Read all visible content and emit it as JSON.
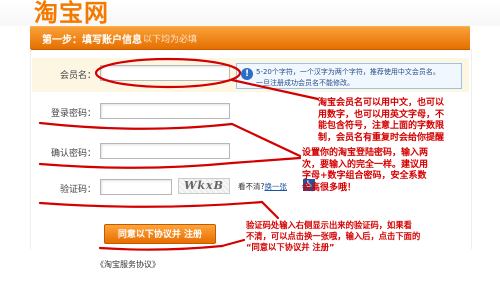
{
  "header": {
    "logo_partial": "淘宝网"
  },
  "step": {
    "title": "第一步：填写账户信息",
    "hint": "以下均为必填"
  },
  "form": {
    "username_label": "会员名：",
    "password_label": "登录密码：",
    "confirm_label": "确认密码：",
    "captcha_label": "验证码：",
    "username_tip_line1": "5-20个字符，一个汉字为两个字符，推荐使用中文会员名。",
    "username_tip_line2": "一旦注册成功会员名不能修改。",
    "captcha_text": "WkxB",
    "refresh_prefix": "看不清?",
    "refresh_link": "换一张",
    "agree_button": "同意以下协议并 注册",
    "agreement_link": "《淘宝服务协议》"
  },
  "annotations": {
    "username_note": [
      "淘宝会员名可以用中文，也可以",
      "用数字，也可以用英文字母，不",
      "能包含符号，注意上面的字数限",
      "制，会员名有重复时会给你提醒"
    ],
    "password_note": [
      "设置你的淘宝登陆密码，输入两",
      "次，要输入的完全一样。建议用",
      "字母+数字组合密码，安全系数",
      "会高很多哦！"
    ],
    "captcha_note": [
      "验证码处输入右侧显示出来的验证码，如果看",
      "不清，可以点击换一张哦，输入后，点击下面的",
      "“同意以下协议并 注册”"
    ]
  },
  "colors": {
    "accent_orange": "#f08300",
    "annotation_red": "#d40000",
    "link_blue": "#1a55a8"
  }
}
